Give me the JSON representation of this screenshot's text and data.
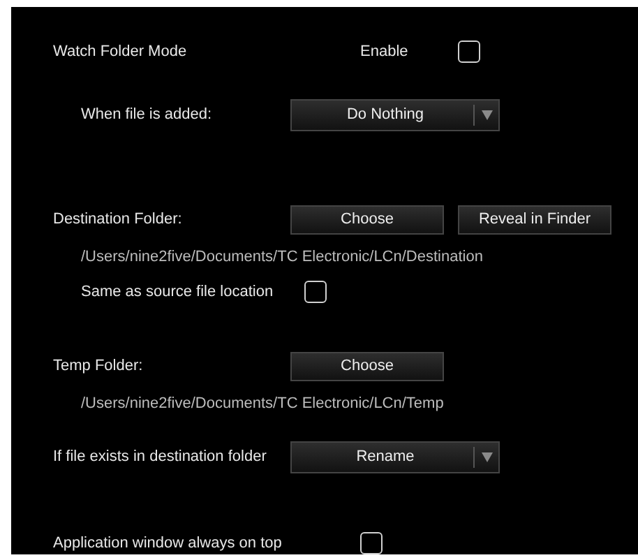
{
  "watch_folder_mode": {
    "label": "Watch Folder Mode",
    "enable_label": "Enable",
    "checked": false
  },
  "when_file_added": {
    "label": "When file is added:",
    "value": "Do Nothing"
  },
  "destination_folder": {
    "label": "Destination Folder:",
    "buttons": [
      "Choose",
      "Reveal in Finder"
    ],
    "path": "/Users/nine2five/Documents/TC Electronic/LCn/Destination",
    "same_as_source": {
      "label": "Same as source file location",
      "checked": false
    }
  },
  "temp_folder": {
    "label": "Temp Folder:",
    "button": "Choose",
    "path": "/Users/nine2five/Documents/TC Electronic/LCn/Temp"
  },
  "if_file_exists": {
    "label": "If file exists in destination folder",
    "value": "Rename"
  },
  "always_on_top": {
    "label": "Application window always on top",
    "checked": false
  }
}
